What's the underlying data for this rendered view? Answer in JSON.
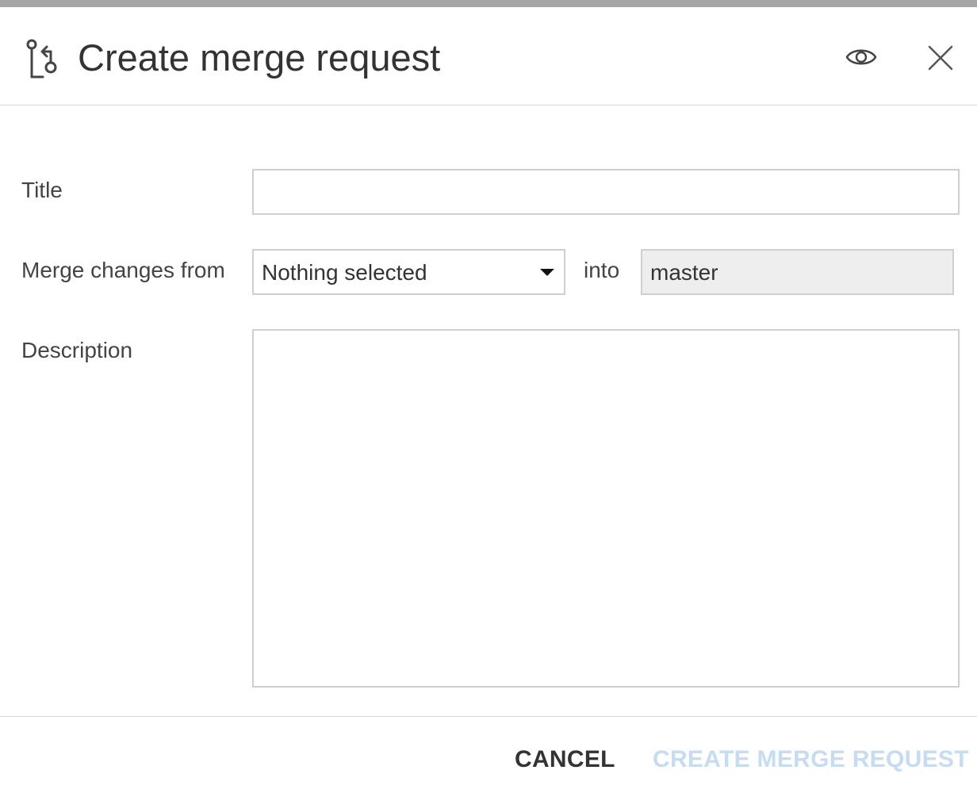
{
  "dialog": {
    "title": "Create merge request",
    "icons": {
      "header": "merge-request-icon",
      "preview": "eye-icon",
      "close": "close-icon"
    }
  },
  "form": {
    "title_label": "Title",
    "title_value": "",
    "merge_from_label": "Merge changes from",
    "source_branch_selected": "Nothing selected",
    "into_label": "into",
    "target_branch": "master",
    "description_label": "Description",
    "description_value": ""
  },
  "footer": {
    "cancel_label": "CANCEL",
    "create_label": "CREATE MERGE REQUEST"
  },
  "colors": {
    "top_strip": "#a6a6a6",
    "text": "#333333",
    "border": "#cfcfcf",
    "readonly_bg": "#eeeeee",
    "disabled_primary": "#c5dcf3"
  }
}
